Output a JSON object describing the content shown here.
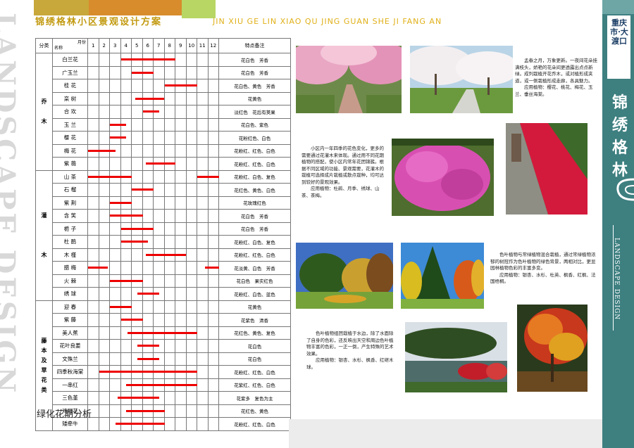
{
  "header": {
    "title": "锦绣格林小区景观设计方案",
    "pinyin": "JIN XIU GE LIN XIAO QU JING GUAN SHE JI FANG AN"
  },
  "watermark": "LANDSCAPE DESIGN",
  "right_panel": {
    "city": "重庆市·大渡口",
    "brand": "锦绣格林",
    "landscape": "LANDSCAPE  DESIGN"
  },
  "table": {
    "col_category": "分类",
    "col_month": "月份",
    "col_name": "名称",
    "months": [
      "1",
      "2",
      "3",
      "4",
      "5",
      "6",
      "7",
      "8",
      "9",
      "10",
      "11",
      "12"
    ],
    "col_note": "特点备注",
    "groups": [
      {
        "name": "乔\n\n木",
        "rows": [
          {
            "name": "白兰花",
            "note": "花白色　芳香",
            "bars": [
              [
                4,
                8
              ]
            ]
          },
          {
            "name": "广玉兰",
            "note": "花白色　芳香",
            "bars": [
              [
                5,
                6
              ]
            ]
          },
          {
            "name": "桂 花",
            "note": "花白色、黄色　芳香",
            "bars": [
              [
                8,
                10
              ]
            ]
          },
          {
            "name": "栾 树",
            "note": "花黄色",
            "bars": [
              [
                5.3,
                7
              ]
            ]
          },
          {
            "name": "合 欢",
            "note": "淡红色　花后有荚果",
            "bars": [
              [
                6,
                6.5
              ]
            ]
          },
          {
            "name": "玉 兰",
            "note": "花白色、紫色",
            "bars": [
              [
                3,
                3.5
              ]
            ]
          },
          {
            "name": "樱 花",
            "note": "花粉红色、白色",
            "bars": [
              [
                3,
                3.5
              ]
            ]
          },
          {
            "name": "梅 花",
            "note": "花粉红、红色、白色",
            "bars": [
              [
                1,
                2.5
              ]
            ]
          },
          {
            "name": "紫 薇",
            "note": "花粉红、红色、白色",
            "bars": [
              [
                6.3,
                8
              ]
            ]
          }
        ]
      },
      {
        "name": "灌\n\n\n\n木",
        "rows": [
          {
            "name": "山 茶",
            "note": "花粉红、白色、复色",
            "bars": [
              [
                1,
                4
              ],
              [
                11,
                12
              ]
            ]
          },
          {
            "name": "石 榴",
            "note": "花红色、黄色、白色",
            "bars": [
              [
                5,
                6
              ]
            ]
          },
          {
            "name": "紫 荆",
            "note": "花玫瑰红色",
            "bars": [
              [
                3,
                4
              ]
            ]
          },
          {
            "name": "含 笑",
            "note": "花白色　芳香",
            "bars": [
              [
                3,
                5
              ]
            ]
          },
          {
            "name": "栀 子",
            "note": "花白色　芳香",
            "bars": [
              [
                4,
                6
              ]
            ]
          },
          {
            "name": "杜 鹃",
            "note": "花粉红、白色、复色",
            "bars": [
              [
                4,
                5.5
              ]
            ]
          },
          {
            "name": "木 槿",
            "note": "花粉红、红色、白色",
            "bars": [
              [
                6.3,
                9
              ]
            ]
          },
          {
            "name": "腊 梅",
            "note": "花淡黄、白色　芳香",
            "bars": [
              [
                1,
                1.8
              ],
              [
                11.7,
                12
              ]
            ]
          },
          {
            "name": "火 棘",
            "note": "花白色　果实红色",
            "bars": [
              [
                3,
                5
              ]
            ]
          },
          {
            "name": "绣 球",
            "note": "花粉红、白色、蓝色",
            "bars": [
              [
                5.5,
                6.5
              ]
            ]
          }
        ]
      },
      {
        "name": "藤\n本\n及\n草\n花\n类",
        "rows": [
          {
            "name": "迎 春",
            "note": "花黄色",
            "bars": [
              [
                3,
                4
              ]
            ]
          },
          {
            "name": "紫 藤",
            "note": "花紫色　清香",
            "bars": [
              [
                4,
                5
              ]
            ]
          },
          {
            "name": "美人蕉",
            "note": "花红色、黄色、复色",
            "bars": [
              [
                4.6,
                10
              ]
            ]
          },
          {
            "name": "花叶良姜",
            "note": "花白色",
            "bars": [
              [
                5.5,
                6.5
              ]
            ]
          },
          {
            "name": "文殊兰",
            "note": "花白色",
            "bars": [
              [
                5.5,
                6.5
              ]
            ]
          },
          {
            "name": "四季秋海棠",
            "note": "花粉红、红色、白色",
            "bars": [
              [
                2,
                10
              ]
            ]
          },
          {
            "name": "一串红",
            "note": "花紫红、红色、白色",
            "bars": [
              [
                4.5,
                10
              ]
            ]
          },
          {
            "name": "三色堇",
            "note": "花紫多　复色为主",
            "bars": [
              [
                3.7,
                6.5
              ]
            ]
          },
          {
            "name": "鸡冠花",
            "note": "花红色、黄色",
            "bars": [
              [
                4.5,
                7
              ]
            ]
          },
          {
            "name": "矮牵牛",
            "note": "花粉红、红色、白色",
            "bars": [
              [
                3.5,
                7
              ]
            ]
          }
        ]
      }
    ]
  },
  "caption": "绿化花期分析",
  "texts": {
    "t1": "　　孟春之月，万象更新。一夜间花朵挂满枝头，娇艳的花朵间更透露出点点新绿。成列栽植开花乔木，或对植形成夹道，或一侧栽植形成走廊，各具魅力。\n　　应用植物：樱花、桃花、梅花、玉兰、垂丝海棠。",
    "t2": "　　小区内一年四季的花色变化，更多的需要通过花灌木来体现。通过用不同花期植物的搭配，使小区内常年花团锦簇。根据不同区域的功能、景观需要，花灌木的栽植可选择成片栽植或散点栽种，均可达到较好的景观效果。\n　　应用植物：杜鹃、月季、绣球、山茶、茶梅。",
    "t3": "　　色叶植物与常绿植物混合栽植，通过常绿植物浓郁的树冠作为色叶植物的绿色背景，两相对比，更显园林植物色彩的丰富多变。\n　　应用植物：银杏、水杉、杜英、枫香、红枫、法国梧桐。",
    "t4": "　　色叶植物组团栽植于水边，除了水面除了自身的色彩，还反映出天空和周边色叶植物丰富的色彩，一正一倒，产生特殊的艺术效果。\n　　应用植物：银杏、水杉、枫香、红继木球。"
  },
  "colors": {
    "bar": "#ee0000",
    "teal": "#3e7f80",
    "gold": "#c29a10"
  }
}
